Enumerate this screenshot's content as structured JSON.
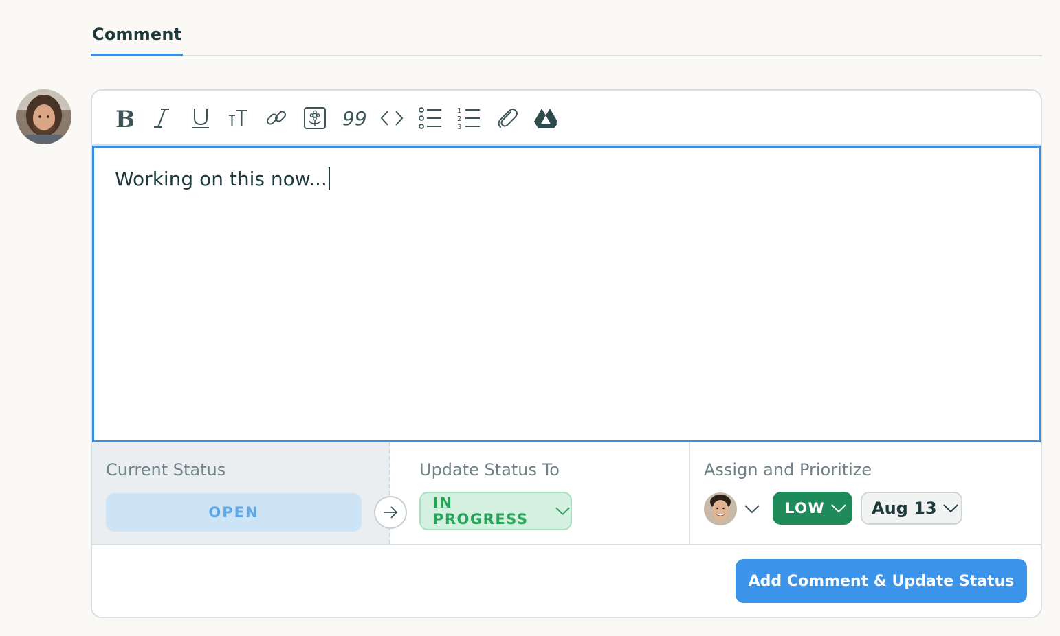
{
  "tabs": [
    {
      "label": "Comment",
      "active": true
    }
  ],
  "commenter": {
    "avatar": "avatar-bearded-man"
  },
  "toolbar": {
    "items": [
      {
        "name": "bold-icon"
      },
      {
        "name": "italic-icon"
      },
      {
        "name": "underline-icon"
      },
      {
        "name": "text-size-icon"
      },
      {
        "name": "link-icon"
      },
      {
        "name": "image-icon"
      },
      {
        "name": "quote-icon",
        "glyph": "99"
      },
      {
        "name": "code-icon"
      },
      {
        "name": "bullet-list-icon"
      },
      {
        "name": "numbered-list-icon"
      },
      {
        "name": "attachment-icon"
      },
      {
        "name": "google-drive-icon"
      }
    ]
  },
  "editor": {
    "value": "Working on this now..."
  },
  "status": {
    "current_label": "Current Status",
    "current_value": "OPEN",
    "update_label": "Update Status To",
    "update_value": "IN PROGRESS",
    "assign_label": "Assign and Prioritize",
    "priority": "LOW",
    "due_date": "Aug 13"
  },
  "actions": {
    "submit_label": "Add Comment & Update Status"
  },
  "colors": {
    "accent": "#3b8fe0",
    "open": "#5ea6e6",
    "in_progress": "#27a35a",
    "low": "#1f8a5a"
  }
}
